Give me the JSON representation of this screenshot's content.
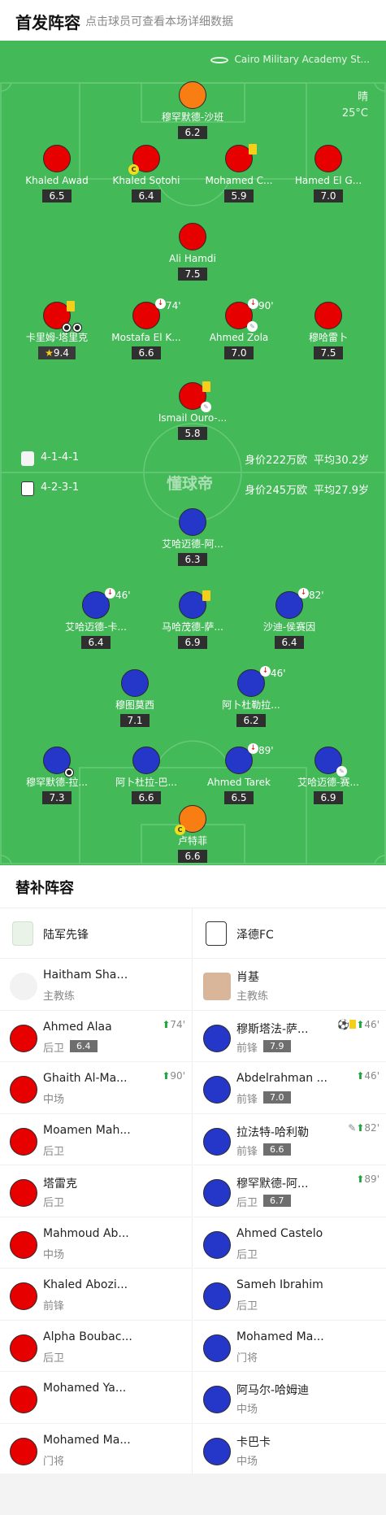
{
  "header": {
    "title": "首发阵容",
    "subtitle": "点击球员可查看本场详细数据"
  },
  "pitch": {
    "stadium": "Cairo Military Academy St...",
    "weather": "晴",
    "temp": "25°C",
    "watermark": "懂球帝",
    "home": {
      "formation": "4-1-4-1",
      "value": "身价222万欧",
      "age": "平均30.2岁"
    },
    "away": {
      "formation": "4-2-3-1",
      "value": "身价245万欧",
      "age": "平均27.9岁"
    }
  },
  "home_players": [
    {
      "name": "穆罕默德-沙班",
      "rating": "6.2"
    },
    {
      "name": "Khaled Awad",
      "rating": "6.5"
    },
    {
      "name": "Khaled Sotohi",
      "rating": "6.4"
    },
    {
      "name": "Mohamed C...",
      "rating": "5.9"
    },
    {
      "name": "Hamed El G...",
      "rating": "7.0"
    },
    {
      "name": "Ali Hamdi",
      "rating": "7.5"
    },
    {
      "name": "卡里姆-塔里克",
      "rating": "9.4"
    },
    {
      "name": "Mostafa El K...",
      "rating": "6.6",
      "sub": "74'"
    },
    {
      "name": "Ahmed Zola",
      "rating": "7.0",
      "sub": "90'"
    },
    {
      "name": "穆哈雷卜",
      "rating": "7.5"
    },
    {
      "name": "Ismail Ouro-...",
      "rating": "5.8"
    }
  ],
  "away_players": [
    {
      "name": "艾哈迈德-阿...",
      "rating": "6.3"
    },
    {
      "name": "艾哈迈德-卡...",
      "rating": "6.4",
      "sub": "46'"
    },
    {
      "name": "马哈茂德-萨...",
      "rating": "6.9"
    },
    {
      "name": "沙迪-侯赛因",
      "rating": "6.4",
      "sub": "82'"
    },
    {
      "name": "穆图莫西",
      "rating": "7.1"
    },
    {
      "name": "阿卜杜勒拉...",
      "rating": "6.2",
      "sub": "46'"
    },
    {
      "name": "穆罕默德-拉...",
      "rating": "7.3"
    },
    {
      "name": "阿卜杜拉-巴...",
      "rating": "6.6"
    },
    {
      "name": "Ahmed Tarek",
      "rating": "6.5",
      "sub": "89'"
    },
    {
      "name": "艾哈迈德-赛...",
      "rating": "6.9"
    },
    {
      "name": "卢特菲",
      "rating": "6.6"
    }
  ],
  "subs": {
    "title": "替补阵容",
    "home": {
      "team": "陆军先锋",
      "coach": {
        "name": "Haitham Shaaban",
        "role": "主教练"
      },
      "players": [
        {
          "name": "Ahmed Alaa",
          "pos": "后卫",
          "rating": "6.4",
          "event": "74'"
        },
        {
          "name": "Ghaith Al-Ma...",
          "pos": "中场",
          "event": "90'"
        },
        {
          "name": "Moamen Mah...",
          "pos": "后卫"
        },
        {
          "name": "塔雷克",
          "pos": "后卫"
        },
        {
          "name": "Mahmoud Ab...",
          "pos": "中场"
        },
        {
          "name": "Khaled Abozi...",
          "pos": "前锋"
        },
        {
          "name": "Alpha Boubac...",
          "pos": "后卫"
        },
        {
          "name": "Mohamed Ya...",
          "pos": ""
        },
        {
          "name": "Mohamed Ma...",
          "pos": "门将"
        }
      ]
    },
    "away": {
      "team": "泽德FC",
      "coach": {
        "name": "肖基",
        "role": "主教练"
      },
      "players": [
        {
          "name": "穆斯塔法-萨...",
          "pos": "前锋",
          "rating": "7.9",
          "event": "46'"
        },
        {
          "name": "Abdelrahman ...",
          "pos": "前锋",
          "rating": "7.0",
          "event": "46'"
        },
        {
          "name": "拉法特-哈利勒",
          "pos": "前锋",
          "rating": "6.6",
          "event": "82'"
        },
        {
          "name": "穆罕默德-阿...",
          "pos": "后卫",
          "rating": "6.7",
          "event": "89'"
        },
        {
          "name": "Ahmed Castelo",
          "pos": "后卫"
        },
        {
          "name": "Sameh Ibrahim",
          "pos": "后卫"
        },
        {
          "name": "Mohamed Ma...",
          "pos": "门将"
        },
        {
          "name": "阿马尔-哈姆迪",
          "pos": "中场"
        },
        {
          "name": "卡巴卡",
          "pos": "中场"
        }
      ]
    }
  }
}
